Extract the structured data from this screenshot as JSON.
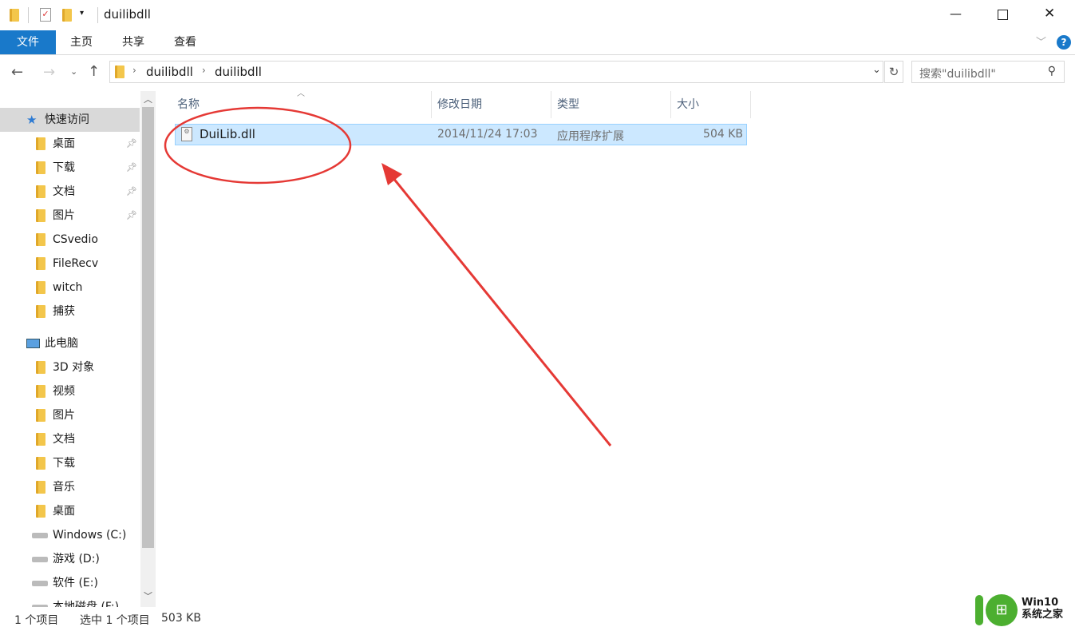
{
  "window": {
    "title": "duilibdll",
    "minimize": "—",
    "maximize": "☐",
    "close": "✕"
  },
  "ribbon": {
    "tabs": [
      "文件",
      "主页",
      "共享",
      "查看"
    ],
    "help": "?"
  },
  "address": {
    "path": [
      "duilibdll",
      "duilibdll"
    ],
    "search_placeholder": "搜索\"duilibdll\""
  },
  "sidebar": {
    "quick_access": "快速访问",
    "quick_items": [
      {
        "label": "桌面",
        "pinned": true
      },
      {
        "label": "下载",
        "pinned": true
      },
      {
        "label": "文档",
        "pinned": true
      },
      {
        "label": "图片",
        "pinned": true
      },
      {
        "label": "CSvedio"
      },
      {
        "label": "FileRecv"
      },
      {
        "label": "witch"
      },
      {
        "label": "捕获"
      }
    ],
    "this_pc": "此电脑",
    "pc_items": [
      "3D 对象",
      "视频",
      "图片",
      "文档",
      "下载",
      "音乐",
      "桌面",
      "Windows (C:)",
      "游戏 (D:)",
      "软件 (E:)",
      "本地磁盘 (F:)"
    ]
  },
  "columns": [
    "名称",
    "修改日期",
    "类型",
    "大小"
  ],
  "files": [
    {
      "name": "DuiLib.dll",
      "modified": "2014/11/24 17:03",
      "type": "应用程序扩展",
      "size": "504 KB",
      "selected": true
    }
  ],
  "status": {
    "count": "1 个项目",
    "selected": "选中 1 个项目",
    "size": "503 KB"
  },
  "watermark": {
    "line1": "Win10",
    "line2": "系统之家"
  },
  "colors": {
    "accent": "#1979ca",
    "selection": "#cce8ff",
    "annotation": "#e53935"
  }
}
